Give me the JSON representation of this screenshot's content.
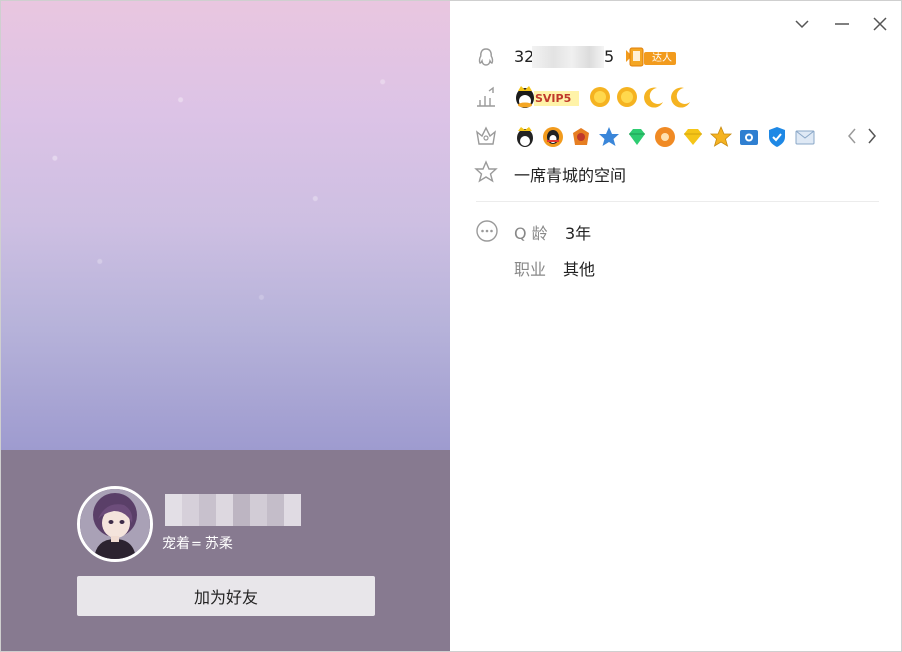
{
  "profile": {
    "qq_prefix": "32",
    "qq_suffix": "5",
    "daren_badge": "达人",
    "svip_badge": "SVIP5",
    "level_icons": [
      "sun-icon",
      "sun-icon",
      "moon-icon",
      "moon-icon"
    ],
    "service_icons": [
      "qq-member-icon",
      "qq-penguin-icon",
      "game-icon",
      "star-icon",
      "diamond-icon",
      "music-icon",
      "yellow-diamond-icon",
      "gold-star-icon",
      "photo-icon",
      "security-icon",
      "mail-icon"
    ],
    "space_name": "一席青城的空间",
    "age_label": "Q 龄",
    "age_value": "3年",
    "job_label": "职业",
    "job_value": "其他"
  },
  "card": {
    "pet_label": "宠着",
    "pet_name": "苏柔",
    "add_friend": "加为好友"
  },
  "colors": {
    "band": "#877a90",
    "button": "#e8e6ea",
    "accent_orange": "#f29b1d",
    "icon_gray": "#9a9a9a"
  }
}
